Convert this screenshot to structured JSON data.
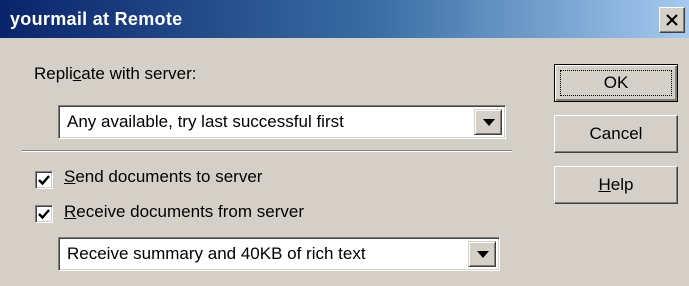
{
  "window": {
    "title": "yourmail at Remote"
  },
  "replicate": {
    "label": {
      "pre": "Repli",
      "key": "c",
      "post": "ate with server:"
    },
    "selected": "Any available, try last successful first"
  },
  "send_documents": {
    "checked": true,
    "label": {
      "pre": "",
      "key": "S",
      "post": "end documents to server"
    }
  },
  "receive_documents": {
    "checked": true,
    "label": {
      "pre": "",
      "key": "R",
      "post": "eceive documents from server"
    },
    "selected": "Receive summary and 40KB of rich text"
  },
  "buttons": {
    "ok": {
      "pre": "",
      "key": "",
      "post": "OK"
    },
    "cancel": {
      "pre": "",
      "key": "",
      "post": "Cancel"
    },
    "help": {
      "pre": "",
      "key": "H",
      "post": "elp"
    }
  },
  "icons": {
    "close": "close-icon",
    "dropdown": "chevron-down-icon",
    "check": "checkmark-icon"
  }
}
